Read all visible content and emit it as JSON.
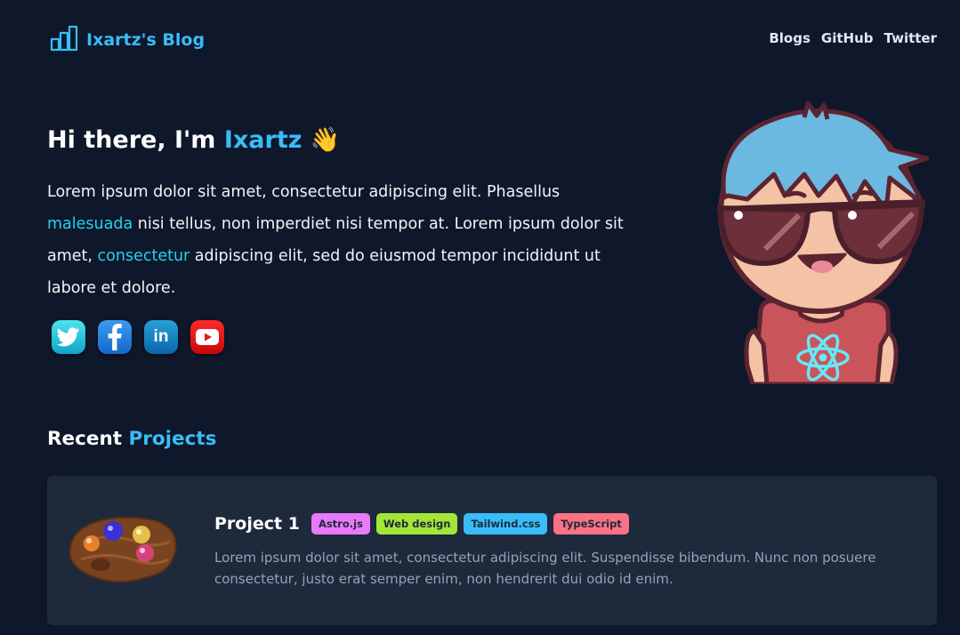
{
  "header": {
    "brand": "Ixartz's Blog",
    "nav": [
      "Blogs",
      "GitHub",
      "Twitter"
    ]
  },
  "hero": {
    "title_prefix": "Hi there, I'm ",
    "title_name": "Ixartz",
    "title_emoji": "👋",
    "text_1": "Lorem ipsum dolor sit amet, consectetur adipiscing elit. Phasellus ",
    "link_1": "malesuada",
    "text_2": " nisi tellus, non imperdiet nisi tempor at. Lorem ipsum dolor sit amet, ",
    "link_2": "consectetur",
    "text_3": " adipiscing elit, sed do eiusmod tempor incididunt ut labore et dolore.",
    "socials": [
      "twitter-icon",
      "facebook-icon",
      "linkedin-icon",
      "youtube-icon"
    ]
  },
  "projects": {
    "title_prefix": "Recent ",
    "title_accent": "Projects",
    "items": [
      {
        "name": "Project 1",
        "tags": [
          {
            "label": "Astro.js",
            "color": "#e879f9"
          },
          {
            "label": "Web design",
            "color": "#a3e635"
          },
          {
            "label": "Tailwind.css",
            "color": "#38bdf8"
          },
          {
            "label": "TypeScript",
            "color": "#fb7185"
          }
        ],
        "description": "Lorem ipsum dolor sit amet, consectetur adipiscing elit. Suspendisse bibendum. Nunc non posuere consectetur, justo erat semper enim, non hendrerit dui odio id enim."
      }
    ]
  },
  "colors": {
    "background": "#0f172a",
    "card": "#1e293b",
    "accent": "#38bdf8"
  }
}
